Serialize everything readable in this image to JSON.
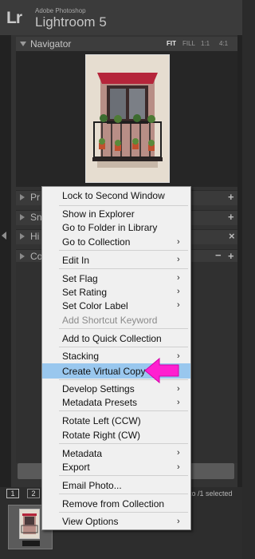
{
  "app": {
    "vendor": "Adobe Photoshop",
    "name": "Lightroom 5",
    "logo": "Lr"
  },
  "navigator": {
    "title": "Navigator",
    "options": [
      "FIT",
      "FILL",
      "1:1",
      "4:1"
    ],
    "active_option": "FIT"
  },
  "panels": [
    {
      "label": "Pr",
      "action": "+"
    },
    {
      "label": "Sn",
      "action": "+"
    },
    {
      "label": "Hi",
      "action": "×"
    },
    {
      "label": "Co",
      "action_minus": "−",
      "action": "+"
    }
  ],
  "filmstrip": {
    "pages": [
      "1",
      "2"
    ],
    "status": "to /1 selected"
  },
  "context_menu": {
    "items": [
      {
        "label": "Lock to Second Window",
        "submenu": false
      },
      {
        "label": "Show in Explorer",
        "submenu": false
      },
      {
        "label": "Go to Folder in Library",
        "submenu": false
      },
      {
        "label": "Go to Collection",
        "submenu": true
      },
      {
        "label": "Edit In",
        "submenu": true
      },
      {
        "label": "Set Flag",
        "submenu": true
      },
      {
        "label": "Set Rating",
        "submenu": true
      },
      {
        "label": "Set Color Label",
        "submenu": true
      },
      {
        "label": "Add Shortcut Keyword",
        "submenu": false,
        "disabled": true
      },
      {
        "label": "Add to Quick Collection",
        "submenu": false
      },
      {
        "label": "Stacking",
        "submenu": true
      },
      {
        "label": "Create Virtual Copy",
        "submenu": false,
        "highlighted": true
      },
      {
        "label": "Develop Settings",
        "submenu": true
      },
      {
        "label": "Metadata Presets",
        "submenu": true
      },
      {
        "label": "Rotate Left (CCW)",
        "submenu": false
      },
      {
        "label": "Rotate Right (CW)",
        "submenu": false
      },
      {
        "label": "Metadata",
        "submenu": true
      },
      {
        "label": "Export",
        "submenu": true
      },
      {
        "label": "Email Photo...",
        "submenu": false
      },
      {
        "label": "Remove from Collection",
        "submenu": false
      },
      {
        "label": "View Options",
        "submenu": true
      }
    ],
    "submenu_glyph": "›"
  },
  "colors": {
    "highlight": "#99c7ee",
    "pointer_arrow": "#ff1fd0",
    "menu_bg": "#f0f0f0"
  },
  "icons": {
    "pointer": "pink-arrow-icon",
    "logo": "lightroom-logo-icon"
  }
}
